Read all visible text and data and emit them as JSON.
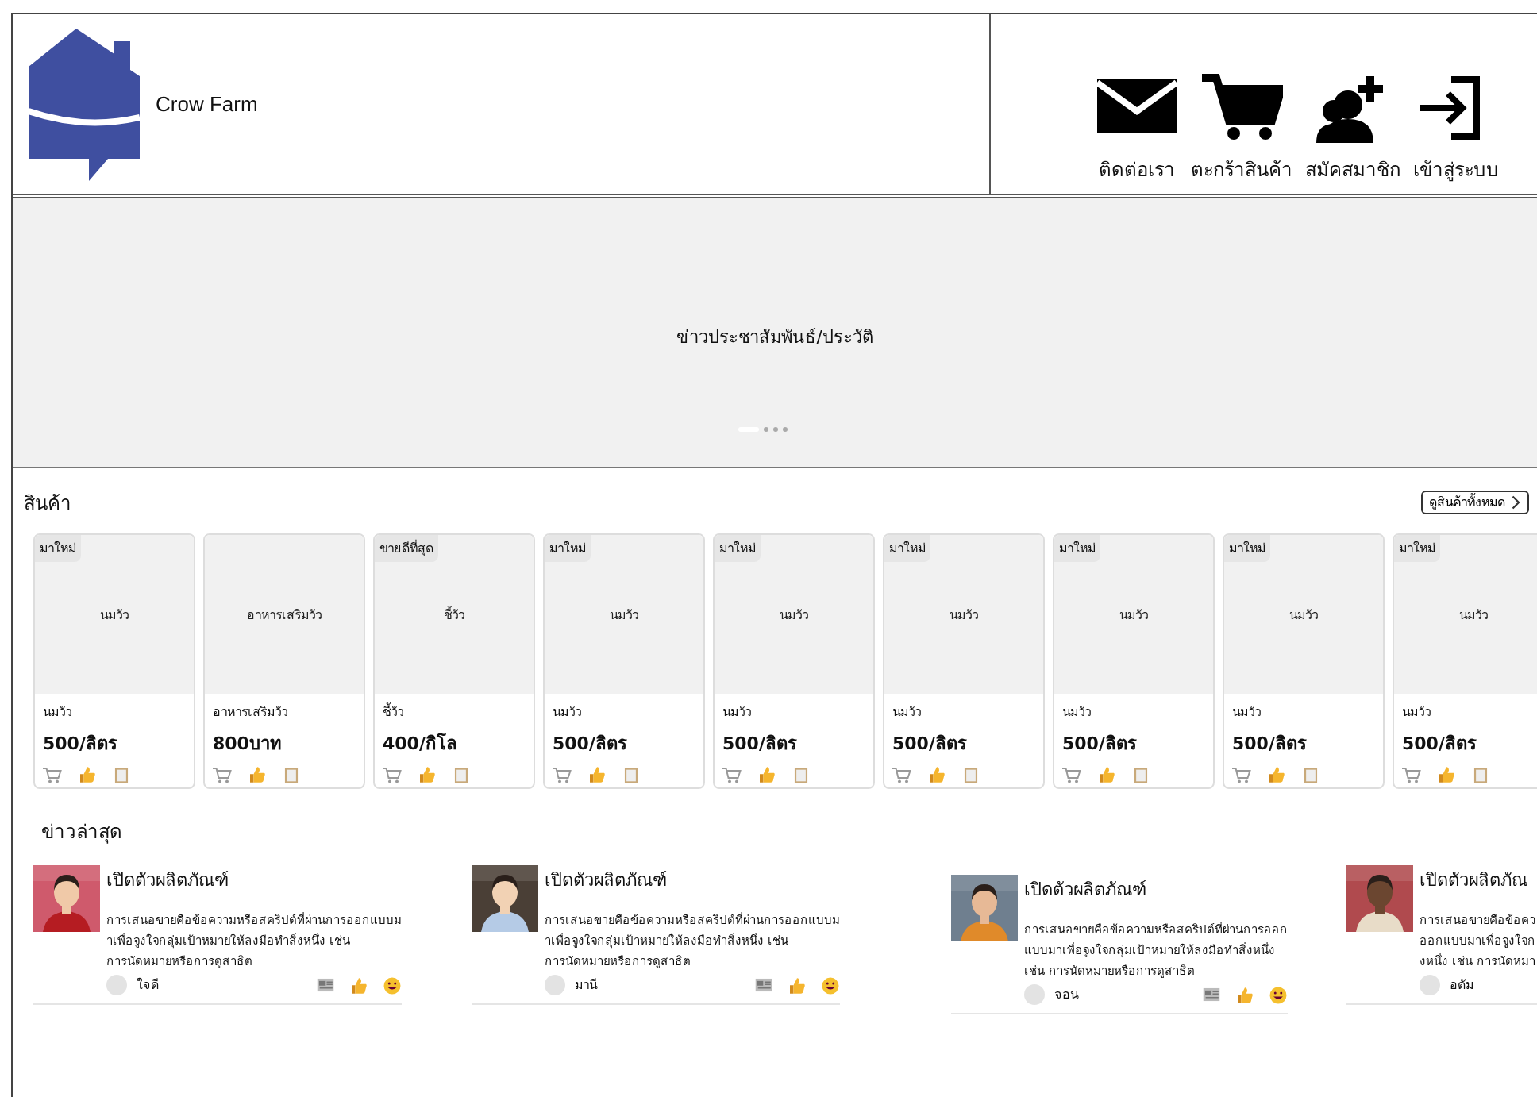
{
  "brand": {
    "name": "Crow Farm"
  },
  "nav": [
    {
      "label": "ติดต่อเรา",
      "kind": "mail"
    },
    {
      "label": "ตะกร้าสินค้า",
      "kind": "cart"
    },
    {
      "label": "สมัคสมาชิก",
      "kind": "signup"
    },
    {
      "label": "เข้าสู่ระบบ",
      "kind": "login"
    }
  ],
  "banner": {
    "title": "ข่าวประชาสัมพันธ์/ประวัติ",
    "slides": [
      {
        "selected": true
      },
      {
        "selected": false
      },
      {
        "selected": false
      },
      {
        "selected": false
      }
    ]
  },
  "products": {
    "title": "สินค้า",
    "view_all": "ดูสินค้าทั้งหมด",
    "items": [
      {
        "badge": "มาใหม่",
        "image_label": "นมวัว",
        "name": "นมวัว",
        "price": "500/ลิตร"
      },
      {
        "image_label": "อาหารเสริมวัว",
        "name": "อาหารเสริมวัว",
        "price": "800บาท"
      },
      {
        "badge": "ขายดีที่สุด",
        "image_label": "ชี้วัว",
        "name": "ชี้วัว",
        "price": "400/กิโล"
      },
      {
        "badge": "มาใหม่",
        "image_label": "นมวัว",
        "name": "นมวัว",
        "price": "500/ลิตร"
      },
      {
        "badge": "มาใหม่",
        "image_label": "นมวัว",
        "name": "นมวัว",
        "price": "500/ลิตร"
      },
      {
        "badge": "มาใหม่",
        "image_label": "นมวัว",
        "name": "นมวัว",
        "price": "500/ลิตร"
      },
      {
        "badge": "มาใหม่",
        "image_label": "นมวัว",
        "name": "นมวัว",
        "price": "500/ลิตร"
      },
      {
        "badge": "มาใหม่",
        "image_label": "นมวัว",
        "name": "นมวัว",
        "price": "500/ลิตร"
      },
      {
        "badge": "มาใหม่",
        "image_label": "นมวัว",
        "name": "นมวัว",
        "price": "500/ลิตร"
      }
    ]
  },
  "news": {
    "title": "ข่าวล่าสุด",
    "items": [
      {
        "title": "เปิดตัวผลิตภัณฑ์",
        "lines": [
          "การเสนอขายคือข้อความหรือสคริปต์ที่ผ่านการออกแบบม",
          "าเพื่อจูงใจกลุ่มเป้าหมายให้ลงมือทำสิ่งหนึ่ง เช่น",
          "การนัดหมายหรือการดูสาธิต"
        ],
        "author": "ใจดี",
        "photo": {
          "kind": "picture"
        }
      },
      {
        "title": "เปิดตัวผลิตภัณฑ์",
        "lines": [
          "การเสนอขายคือข้อความหรือสคริปต์ที่ผ่านการออกแบบม",
          "าเพื่อจูงใจกลุ่มเป้าหมายให้ลงมือทำสิ่งหนึ่ง เช่น",
          "การนัดหมายหรือการดูสาธิต"
        ],
        "author": "มานี",
        "photo": {
          "kind": "picture"
        }
      },
      {
        "title": "เปิดตัวผลิตภัณฑ์",
        "lines": [
          "การเสนอขายคือข้อความหรือสคริปต์ที่ผ่านการออก",
          "แบบมาเพื่อจูงใจกลุ่มเป้าหมายให้ลงมือทำสิ่งหนึ่ง",
          "เช่น การนัดหมายหรือการดูสาธิต"
        ],
        "author": "จอน",
        "photo": {
          "kind": "picture"
        }
      },
      {
        "title": "เปิดตัวผลิตภัณ",
        "lines": [
          "การเสนอขายคือข้อคว",
          "ออกแบบมาเพื่อจูงใจก",
          "งหนึ่ง เช่น การนัดหมา"
        ],
        "author": "อดัม",
        "photo": {
          "kind": "picture"
        },
        "icons": false
      }
    ]
  }
}
